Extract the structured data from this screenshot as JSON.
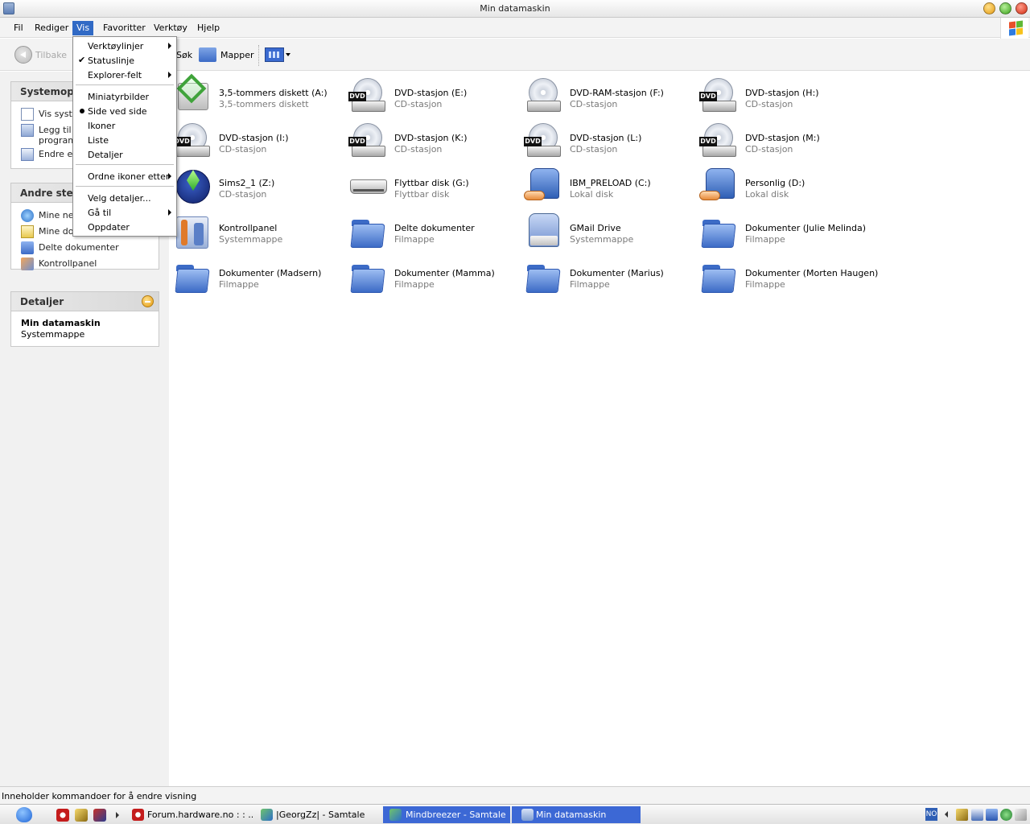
{
  "window": {
    "title": "Min datamaskin"
  },
  "menubar": {
    "items": [
      "Fil",
      "Rediger",
      "Vis",
      "Favoritter",
      "Verktøy",
      "Hjelp"
    ],
    "active": "Vis"
  },
  "toolbar": {
    "back": "Tilbake",
    "search": "Søk",
    "folders": "Mapper"
  },
  "view_menu": {
    "items": [
      {
        "label": "Verktøylinjer",
        "submenu": true
      },
      {
        "label": "Statuslinje",
        "checked": true
      },
      {
        "label": "Explorer-felt",
        "submenu": true
      },
      {
        "label": "Miniatyrbilder"
      },
      {
        "label": "Side ved side",
        "selected": true
      },
      {
        "label": "Ikoner"
      },
      {
        "label": "Liste"
      },
      {
        "label": "Detaljer"
      },
      {
        "label": "Ordne ikoner etter",
        "submenu": true
      },
      {
        "label": "Velg detaljer..."
      },
      {
        "label": "Gå til",
        "submenu": true
      },
      {
        "label": "Oppdater"
      }
    ]
  },
  "sidebar": {
    "system_tasks": {
      "title": "Systemopp",
      "links": [
        {
          "lines": [
            "Vis syste"
          ]
        },
        {
          "lines": [
            "Legg til e",
            "program"
          ]
        },
        {
          "lines": [
            "Endre en"
          ]
        }
      ]
    },
    "other_places": {
      "title": "Andre sted",
      "links": [
        "Mine net",
        "Mine dok",
        "Delte dokumenter",
        "Kontrollpanel"
      ]
    },
    "details": {
      "title": "Detaljer",
      "name": "Min datamaskin",
      "type": "Systemmappe"
    }
  },
  "items": [
    {
      "name": "3,5-tommers diskett (A:)",
      "type": "3,5-tommers diskett",
      "icon": "floppy-icon"
    },
    {
      "name": "DVD-stasjon (E:)",
      "type": "CD-stasjon",
      "icon": "dvd-drive-icon"
    },
    {
      "name": "DVD-RAM-stasjon (F:)",
      "type": "CD-stasjon",
      "icon": "cd-drive-icon"
    },
    {
      "name": "DVD-stasjon (H:)",
      "type": "CD-stasjon",
      "icon": "dvd-drive-icon"
    },
    {
      "name": "DVD-stasjon (I:)",
      "type": "CD-stasjon",
      "icon": "dvd-drive-icon"
    },
    {
      "name": "DVD-stasjon (K:)",
      "type": "CD-stasjon",
      "icon": "dvd-drive-icon"
    },
    {
      "name": "DVD-stasjon (L:)",
      "type": "CD-stasjon",
      "icon": "dvd-drive-icon"
    },
    {
      "name": "DVD-stasjon (M:)",
      "type": "CD-stasjon",
      "icon": "dvd-drive-icon"
    },
    {
      "name": "Sims2_1 (Z:)",
      "type": "CD-stasjon",
      "icon": "sims-disc-icon"
    },
    {
      "name": "Flyttbar disk (G:)",
      "type": "Flyttbar disk",
      "icon": "removable-disk-icon"
    },
    {
      "name": "IBM_PRELOAD (C:)",
      "type": "Lokal disk",
      "icon": "shared-disk-icon"
    },
    {
      "name": "Personlig (D:)",
      "type": "Lokal disk",
      "icon": "shared-disk-icon"
    },
    {
      "name": "Kontrollpanel",
      "type": "Systemmappe",
      "icon": "control-panel-icon"
    },
    {
      "name": "Delte dokumenter",
      "type": "Filmappe",
      "icon": "folder-icon"
    },
    {
      "name": "GMail Drive",
      "type": "Systemmappe",
      "icon": "gmail-drive-icon"
    },
    {
      "name": "Dokumenter (Julie Melinda)",
      "type": "Filmappe",
      "icon": "folder-icon"
    },
    {
      "name": "Dokumenter (Madsern)",
      "type": "Filmappe",
      "icon": "folder-icon"
    },
    {
      "name": "Dokumenter (Mamma)",
      "type": "Filmappe",
      "icon": "folder-icon"
    },
    {
      "name": "Dokumenter (Marius)",
      "type": "Filmappe",
      "icon": "folder-icon"
    },
    {
      "name": "Dokumenter (Morten Haugen)",
      "type": "Filmappe",
      "icon": "folder-icon"
    }
  ],
  "statusbar": {
    "text": "Inneholder kommandoer for å endre visning"
  },
  "taskbar": {
    "tasks": [
      {
        "label": "Forum.hardware.no : : ...",
        "active": false
      },
      {
        "label": "|GeorgZz| - Samtale",
        "active": false
      },
      {
        "label": "Mindbreezer - Samtale",
        "active": true
      },
      {
        "label": "Min datamaskin",
        "active": true
      }
    ],
    "language": "NO"
  },
  "colors": {
    "selection": "#316ac5",
    "folder": "#4a7fd9",
    "text_secondary": "#7a7a7a"
  }
}
